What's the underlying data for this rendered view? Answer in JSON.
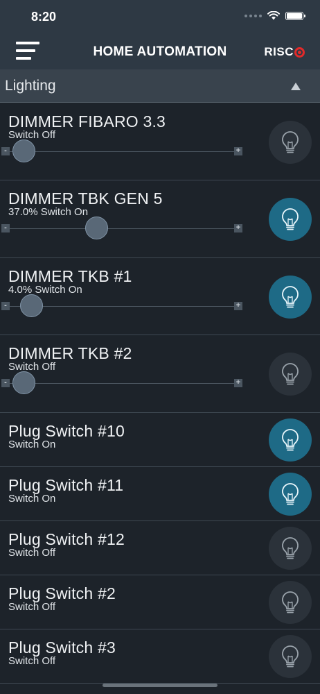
{
  "status_bar": {
    "time": "8:20"
  },
  "header": {
    "title": "HOME AUTOMATION",
    "logo_text": "RISC"
  },
  "section": {
    "title": "Lighting"
  },
  "slider_labels": {
    "minus": "-",
    "plus": "+"
  },
  "devices": [
    {
      "name": "DIMMER FIBARO 3.3",
      "status": "Switch Off",
      "on": false,
      "level_percent": 0
    },
    {
      "name": "DIMMER TBK GEN 5",
      "status": "37.0% Switch On",
      "on": true,
      "level_percent": 37
    },
    {
      "name": "DIMMER TKB #1",
      "status": "4.0% Switch On",
      "on": true,
      "level_percent": 4
    },
    {
      "name": "DIMMER TKB #2",
      "status": "Switch Off",
      "on": false,
      "level_percent": 0
    },
    {
      "name": "Plug Switch #10",
      "status": "Switch On",
      "on": true
    },
    {
      "name": "Plug Switch #11",
      "status": "Switch On",
      "on": true
    },
    {
      "name": "Plug Switch #12",
      "status": "Switch Off",
      "on": false
    },
    {
      "name": "Plug Switch #2",
      "status": "Switch Off",
      "on": false
    },
    {
      "name": "Plug Switch #3",
      "status": "Switch Off",
      "on": false
    }
  ],
  "colors": {
    "on": "#1e6a86",
    "off": "#2b323a",
    "bulb_on": "#e9f6fb",
    "bulb_off": "#9aa3ab",
    "logo_accent": "#e22a2a"
  }
}
